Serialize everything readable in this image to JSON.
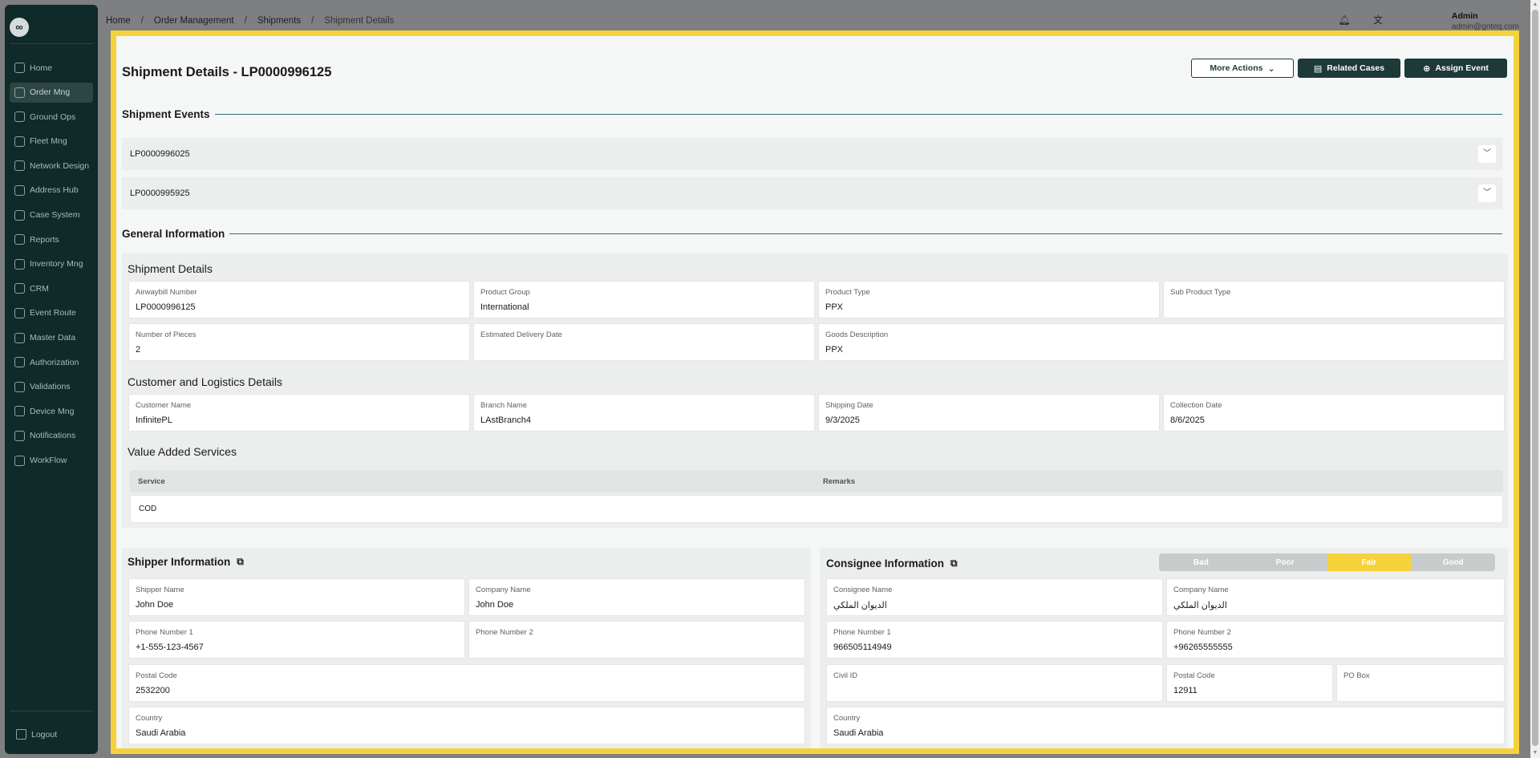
{
  "sidebar": {
    "logo": "∞",
    "items": [
      {
        "label": "Home",
        "icon": "home-icon"
      },
      {
        "label": "Order Mng",
        "icon": "order-icon",
        "active": true
      },
      {
        "label": "Ground Ops",
        "icon": "ground-icon"
      },
      {
        "label": "Fleet Mng",
        "icon": "truck-icon"
      },
      {
        "label": "Network Design",
        "icon": "network-icon"
      },
      {
        "label": "Address Hub",
        "icon": "address-icon"
      },
      {
        "label": "Case System",
        "icon": "case-icon"
      },
      {
        "label": "Reports",
        "icon": "reports-icon"
      },
      {
        "label": "Inventory Mng",
        "icon": "inventory-icon"
      },
      {
        "label": "CRM",
        "icon": "crm-icon"
      },
      {
        "label": "Event Route",
        "icon": "route-icon"
      },
      {
        "label": "Master Data",
        "icon": "database-icon"
      },
      {
        "label": "Authorization",
        "icon": "users-icon"
      },
      {
        "label": "Validations",
        "icon": "validation-icon"
      },
      {
        "label": "Device Mng",
        "icon": "device-icon"
      },
      {
        "label": "Notifications",
        "icon": "bell-icon"
      },
      {
        "label": "WorkFlow",
        "icon": "workflow-icon"
      }
    ],
    "logout": "Logout"
  },
  "topbar": {
    "breadcrumb": [
      "Home",
      "Order Management",
      "Shipments",
      "Shipment Details"
    ],
    "user_name": "Admin",
    "user_email": "admin@gnteq.com"
  },
  "page": {
    "title": "Shipment Details - LP0000996125",
    "actions": {
      "more": "More Actions",
      "related": "Related Cases",
      "assign": "Assign Event"
    }
  },
  "events": {
    "heading": "Shipment Events",
    "items": [
      "LP0000996025",
      "LP0000995925"
    ]
  },
  "general": {
    "heading": "General Information",
    "shipment_details": {
      "heading": "Shipment Details",
      "fields": [
        {
          "label": "Airwaybill Number",
          "value": "LP0000996125"
        },
        {
          "label": "Product Group",
          "value": "International"
        },
        {
          "label": "Product Type",
          "value": "PPX"
        },
        {
          "label": "Sub Product Type",
          "value": ""
        },
        {
          "label": "Number of Pieces",
          "value": "2"
        },
        {
          "label": "Estimated Delivery Date",
          "value": ""
        },
        {
          "label": "Goods Description",
          "value": "PPX"
        }
      ]
    },
    "customer": {
      "heading": "Customer and Logistics Details",
      "fields": [
        {
          "label": "Customer Name",
          "value": "InfinitePL"
        },
        {
          "label": "Branch Name",
          "value": "LAstBranch4"
        },
        {
          "label": "Shipping Date",
          "value": "9/3/2025"
        },
        {
          "label": "Collection Date",
          "value": "8/6/2025"
        }
      ]
    },
    "vas": {
      "heading": "Value Added Services",
      "columns": [
        "Service",
        "Remarks"
      ],
      "rows": [
        [
          "COD",
          ""
        ]
      ]
    }
  },
  "shipper": {
    "heading": "Shipper Information",
    "fields": [
      {
        "label": "Shipper Name",
        "value": "John Doe"
      },
      {
        "label": "Company Name",
        "value": "John Doe"
      },
      {
        "label": "Phone Number 1",
        "value": "+1-555-123-4567"
      },
      {
        "label": "Phone Number 2",
        "value": ""
      },
      {
        "label": "Postal Code",
        "value": "2532200"
      },
      {
        "label": "Country",
        "value": "Saudi Arabia"
      }
    ]
  },
  "consignee": {
    "heading": "Consignee Information",
    "rating": {
      "options": [
        "Bad",
        "Poor",
        "Fair",
        "Good"
      ],
      "selected": "Fair"
    },
    "fields": [
      {
        "label": "Consignee Name",
        "value": "الديوان الملكي"
      },
      {
        "label": "Company Name",
        "value": "الديوان الملكي"
      },
      {
        "label": "Phone Number 1",
        "value": "966505114949"
      },
      {
        "label": "Phone Number 2",
        "value": "+96265555555"
      },
      {
        "label": "Civil ID",
        "value": ""
      },
      {
        "label": "Postal Code",
        "value": "12911"
      },
      {
        "label": "PO Box",
        "value": ""
      },
      {
        "label": "Country",
        "value": "Saudi Arabia"
      }
    ]
  },
  "colors": {
    "sidebar_bg": "#0f2a29",
    "accent_dark": "#1d3938",
    "highlight": "#f6d23a",
    "section_line": "#2e6d86"
  }
}
